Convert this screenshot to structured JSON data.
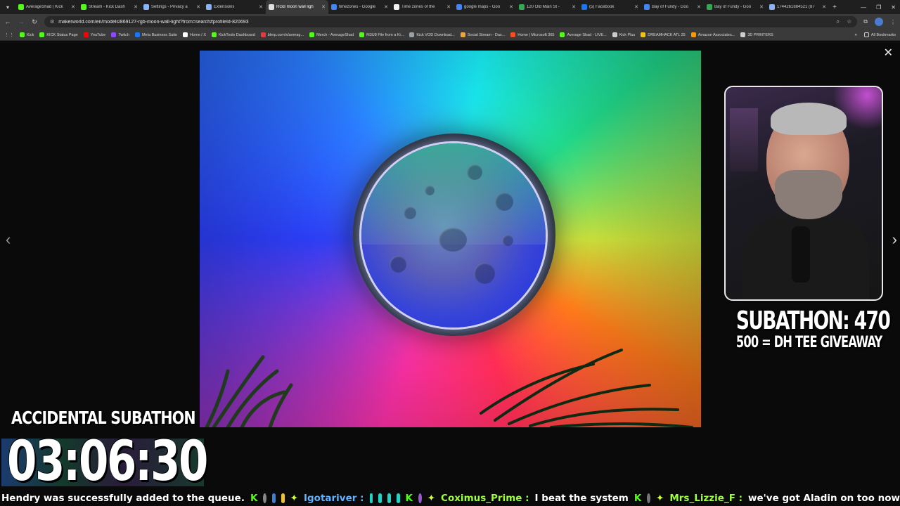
{
  "browser": {
    "tabs": [
      {
        "label": "AverageShad | Kick",
        "color": "#53fc18",
        "active": false
      },
      {
        "label": "Stream - Kick Dash",
        "color": "#53fc18",
        "active": false
      },
      {
        "label": "Settings - Privacy a",
        "color": "#8ab4f8",
        "active": false
      },
      {
        "label": "Extensions",
        "color": "#8ab4f8",
        "active": false
      },
      {
        "label": "RGB moon wall ligh",
        "color": "#e0e0e0",
        "active": true
      },
      {
        "label": "timezones - Google",
        "color": "#4285f4",
        "active": false
      },
      {
        "label": "Time zones of the",
        "color": "#f2f2f2",
        "active": false
      },
      {
        "label": "google maps - Goo",
        "color": "#4285f4",
        "active": false
      },
      {
        "label": "120 Old Main St -",
        "color": "#34a853",
        "active": false
      },
      {
        "label": "(5) Facebook",
        "color": "#1877f2",
        "active": false
      },
      {
        "label": "Bay of Fundy - Goo",
        "color": "#4285f4",
        "active": false
      },
      {
        "label": "Bay of Fundy - Goo",
        "color": "#34a853",
        "active": false
      },
      {
        "label": "1744261884521 (87",
        "color": "#8ab4f8",
        "active": false
      }
    ],
    "url": "makerworld.com/en/models/869127-rgb-moon-wall-light?from=search#profileId-820693",
    "bookmarks": [
      {
        "label": "Kick",
        "color": "#53fc18"
      },
      {
        "label": "KICK Status Page",
        "color": "#53fc18"
      },
      {
        "label": "YouTube",
        "color": "#ff0000"
      },
      {
        "label": "Twitch",
        "color": "#9146ff"
      },
      {
        "label": "Meta Business Suite",
        "color": "#1877f2"
      },
      {
        "label": "Home / X",
        "color": "#ffffff"
      },
      {
        "label": "KickTools Dashboard",
        "color": "#53fc18"
      },
      {
        "label": "blerp.com/x/averag...",
        "color": "#e23b3b"
      },
      {
        "label": "Merch - AverageShad",
        "color": "#53fc18"
      },
      {
        "label": "M3U8 File from a Ki...",
        "color": "#53fc18"
      },
      {
        "label": "Kick VOD Download...",
        "color": "#9aa0a6"
      },
      {
        "label": "Social Stream - Das...",
        "color": "#f2a33a"
      },
      {
        "label": "Home | Microsoft 365",
        "color": "#f25022"
      },
      {
        "label": "Average Shad - LIVE...",
        "color": "#53fc18"
      },
      {
        "label": "Kick Plus",
        "color": "#cccccc"
      },
      {
        "label": "DREAMHACK ATL 25",
        "color": "#f4c20d"
      },
      {
        "label": "Amazon Associates...",
        "color": "#ff9900"
      },
      {
        "label": "3D PRINTERS",
        "color": "#cccccc"
      }
    ],
    "all_bookmarks": "All Bookmarks"
  },
  "overlay": {
    "subathon_count": "SUBATHON: 470",
    "subathon_goal": "500 = DH TEE GIVEAWAY",
    "timer_label": "ACCIDENTAL SUBATHON",
    "timer": "03:06:30"
  },
  "ticker": {
    "msg1": "Hendry was successfully added to the queue.",
    "user1": "Igotariver :",
    "user2": "Coximus_Prime :",
    "msg2": "I beat the system",
    "user3": "Mrs_Lizzie_F :",
    "msg3": "we've got Aladin on too now"
  }
}
